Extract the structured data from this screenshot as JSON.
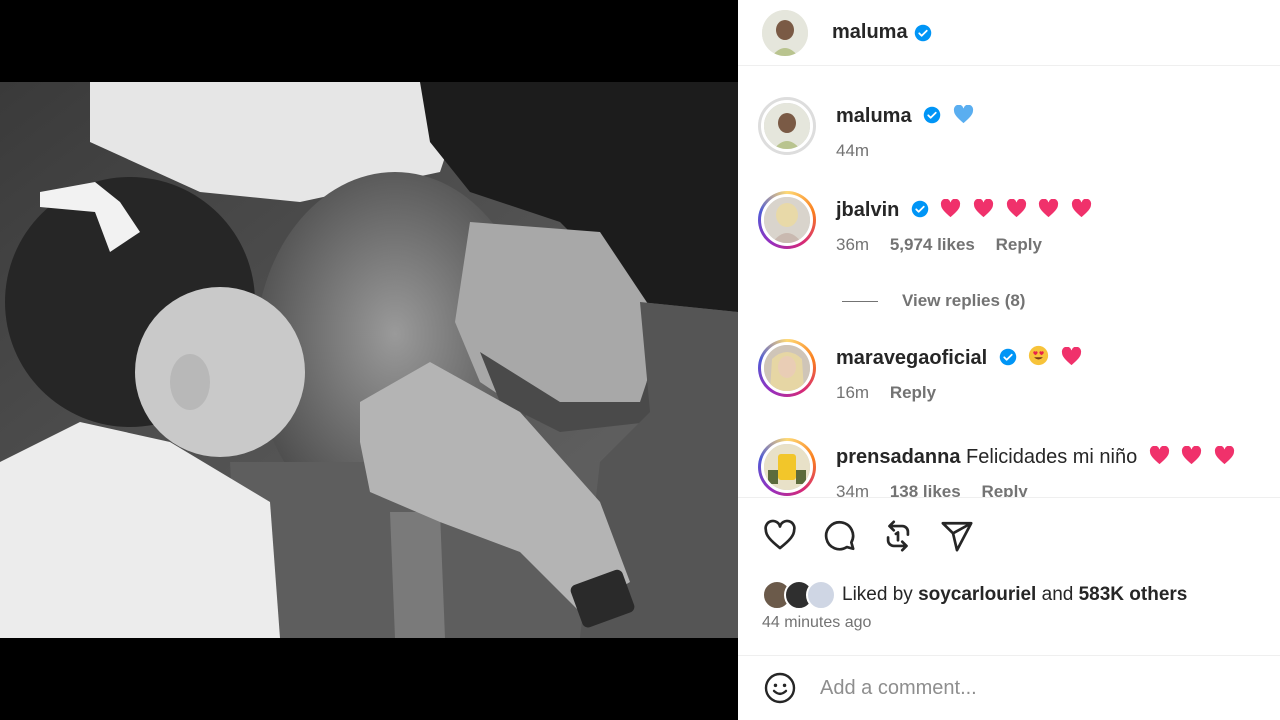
{
  "post": {
    "author": "maluma",
    "author_verified": true
  },
  "caption": {
    "username": "maluma",
    "emoji": "blue-heart",
    "time": "44m"
  },
  "comments": [
    {
      "username": "jbalvin",
      "verified": true,
      "text": "",
      "hearts": 5,
      "time": "36m",
      "likes": "5,974 likes",
      "reply": "Reply"
    },
    {
      "username": "maravegaoficial",
      "verified": true,
      "text": "",
      "emojis": [
        "smiling-face-with-heart-eyes",
        "red-heart"
      ],
      "time": "16m",
      "reply": "Reply"
    },
    {
      "username": "prensadanna",
      "verified": false,
      "text": "Felicidades mi niño",
      "hearts": 3,
      "time": "34m",
      "likes": "138 likes",
      "reply": "Reply"
    }
  ],
  "view_replies": "View replies (8)",
  "actions": {
    "icons": [
      "heart-icon",
      "comment-icon",
      "repost-icon",
      "share-icon"
    ]
  },
  "likes": {
    "prefix": "Liked by",
    "user": "soycarlouriel",
    "conjunction": "and",
    "others": "583K others"
  },
  "post_time": "44 minutes ago",
  "add_comment": {
    "placeholder": "Add a comment..."
  },
  "colors": {
    "verified": "#0095f6",
    "heart": "#f0316b",
    "muted": "#737373"
  }
}
